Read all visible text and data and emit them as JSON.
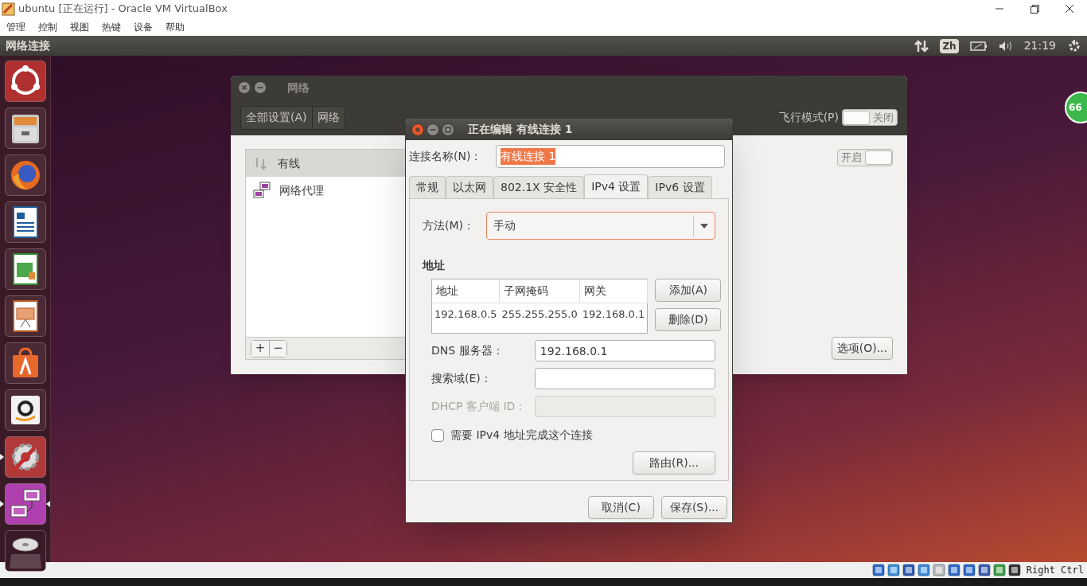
{
  "vbox": {
    "title": "ubuntu [正在运行] - Oracle VM VirtualBox",
    "menu": [
      "管理",
      "控制",
      "视图",
      "热键",
      "设备",
      "帮助"
    ]
  },
  "top_panel": {
    "title": "网络连接",
    "input_method": "Zh",
    "clock": "21:19"
  },
  "launcher": {
    "items": [
      {
        "kind": "ubuntu",
        "running": false,
        "selected": false
      },
      {
        "kind": "files",
        "running": false,
        "selected": false
      },
      {
        "kind": "firefox",
        "running": false,
        "selected": false
      },
      {
        "kind": "writer",
        "running": false,
        "selected": false
      },
      {
        "kind": "calc",
        "running": false,
        "selected": false
      },
      {
        "kind": "impress",
        "running": false,
        "selected": false
      },
      {
        "kind": "store",
        "running": false,
        "selected": false
      },
      {
        "kind": "amazon",
        "running": false,
        "selected": false
      },
      {
        "kind": "settings",
        "running": true,
        "selected": false
      },
      {
        "kind": "network",
        "running": true,
        "selected": true
      },
      {
        "kind": "disc",
        "running": false,
        "selected": false
      }
    ]
  },
  "network_window": {
    "title": "网络",
    "breadcrumbs": [
      "全部设置(A)",
      "网络"
    ],
    "airplane": {
      "label": "飞行模式(P)",
      "on": false,
      "state_text": "关闭"
    },
    "devices": [
      {
        "label": "有线",
        "kind": "wired",
        "selected": true
      },
      {
        "label": "网络代理",
        "kind": "proxy",
        "selected": false
      }
    ],
    "add": "+",
    "remove": "−",
    "wired_switch": {
      "on": true,
      "state_text": "开启"
    },
    "options_button": "选项(O)..."
  },
  "badge": "66",
  "dialog": {
    "title": "正在编辑 有线连接 1",
    "name_field": {
      "label": "连接名称(N)：",
      "value": "有线连接 1",
      "highlighted": true
    },
    "tabs": [
      {
        "label": "常规",
        "selected": false
      },
      {
        "label": "以太网",
        "selected": false
      },
      {
        "label": "802.1X 安全性",
        "selected": false
      },
      {
        "label": "IPv4 设置",
        "selected": true
      },
      {
        "label": "IPv6 设置",
        "selected": false
      }
    ],
    "method": {
      "label": "方法(M)：",
      "value": "手动",
      "focused": true
    },
    "address_heading": "地址",
    "address_table": {
      "columns": [
        "地址",
        "子网掩码",
        "网关"
      ],
      "rows": [
        [
          "192.168.0.5",
          "255.255.255.0",
          "192.168.0.1"
        ]
      ]
    },
    "address_buttons": [
      "添加(A)",
      "删除(D)"
    ],
    "fields": [
      {
        "label": "DNS 服务器：",
        "value": "192.168.0.1",
        "disabled": false
      },
      {
        "label": "搜索域(E)：",
        "disabled": false
      },
      {
        "label": "DHCP 客户端 ID：",
        "disabled": true
      }
    ],
    "require_ipv4": {
      "label": "需要 IPv4 地址完成这个连接",
      "checked": false
    },
    "routes_button": "路由(R)...",
    "buttons": [
      "取消(C)",
      "保存(S)..."
    ]
  },
  "status_bar": {
    "host_key": "Right Ctrl"
  }
}
